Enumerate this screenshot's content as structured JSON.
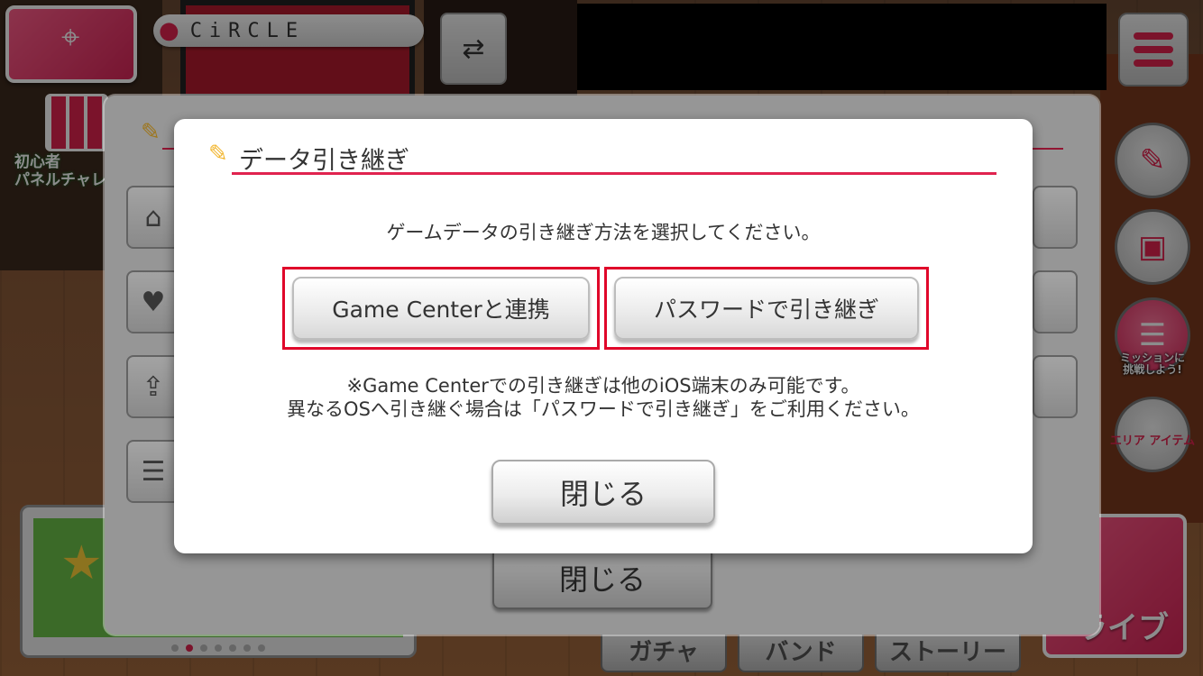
{
  "hud": {
    "location_label": "CiRCLE",
    "novice_label": "初心者\nパネルチャレ",
    "menu_icon": "hamburger-icon",
    "swap_icon": "profile-swap-icon"
  },
  "side_buttons": {
    "mission_caption": "ミッションに\n挑戦しよう!",
    "area_item_caption": "エリア\nアイテム",
    "live_label": "ライブ"
  },
  "bottom_tabs": [
    "ガチャ",
    "バンド",
    "ストーリー"
  ],
  "banner": {
    "dots": 7,
    "active_dot": 2
  },
  "back_dialog": {
    "close_label": "閉じる"
  },
  "dialog": {
    "title": "データ引き継ぎ",
    "prompt": "ゲームデータの引き継ぎ方法を選択してください。",
    "game_center_button": "Game Centerと連携",
    "password_button": "パスワードで引き継ぎ",
    "note_line1": "※Game Centerでの引き継ぎは他のiOS端末のみ可能です。",
    "note_line2": "異なるOSへ引き継ぐ場合は「パスワードで引き継ぎ」をご利用ください。",
    "close_label": "閉じる"
  },
  "colors": {
    "accent": "#e0234f",
    "highlight_border": "#e0072a",
    "pen": "#f2b52d"
  }
}
